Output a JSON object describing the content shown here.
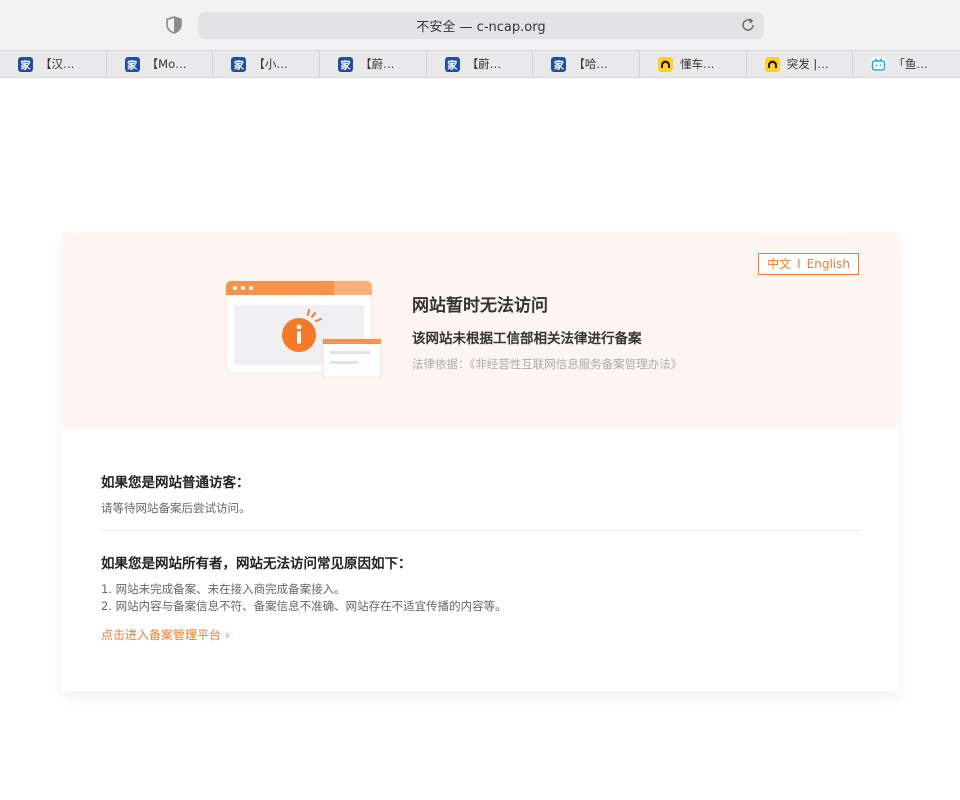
{
  "browser": {
    "address": "不安全 — c-ncap.org"
  },
  "bookmarks": [
    {
      "icon": "autohome-icon",
      "label": "【汉…"
    },
    {
      "icon": "autohome-icon",
      "label": "【Mo…"
    },
    {
      "icon": "autohome-icon",
      "label": "【小…"
    },
    {
      "icon": "autohome-icon",
      "label": "【蔚…"
    },
    {
      "icon": "autohome-icon",
      "label": "【蔚…"
    },
    {
      "icon": "autohome-icon",
      "label": "【哈…"
    },
    {
      "icon": "dongchedi-icon",
      "label": "懂车…"
    },
    {
      "icon": "dongchedi-icon",
      "label": "突发 |…"
    },
    {
      "icon": "bilibili-icon",
      "label": "「鱼…"
    }
  ],
  "banner": {
    "lang_zh": "中文",
    "lang_sep": "I",
    "lang_en": "English",
    "title": "网站暂时无法访问",
    "subtitle": "该网站未根据工信部相关法律进行备案",
    "basis": "法律依据：《非经营性互联网信息服务备案管理办法》"
  },
  "visitor": {
    "title": "如果您是网站普通访客：",
    "text": "请等待网站备案后尝试访问。"
  },
  "owner": {
    "title": "如果您是网站所有者，网站无法访问常见原因如下：",
    "reasons": [
      "1. 网站未完成备案、未在接入商完成备案接入。",
      "2. 网站内容与备案信息不符、备案信息不准确、网站存在不适宜传播的内容等。"
    ],
    "link": "点击进入备案管理平台 ›"
  },
  "colors": {
    "accent": "#f07d2f",
    "banner_bg": "#fff6f2"
  }
}
